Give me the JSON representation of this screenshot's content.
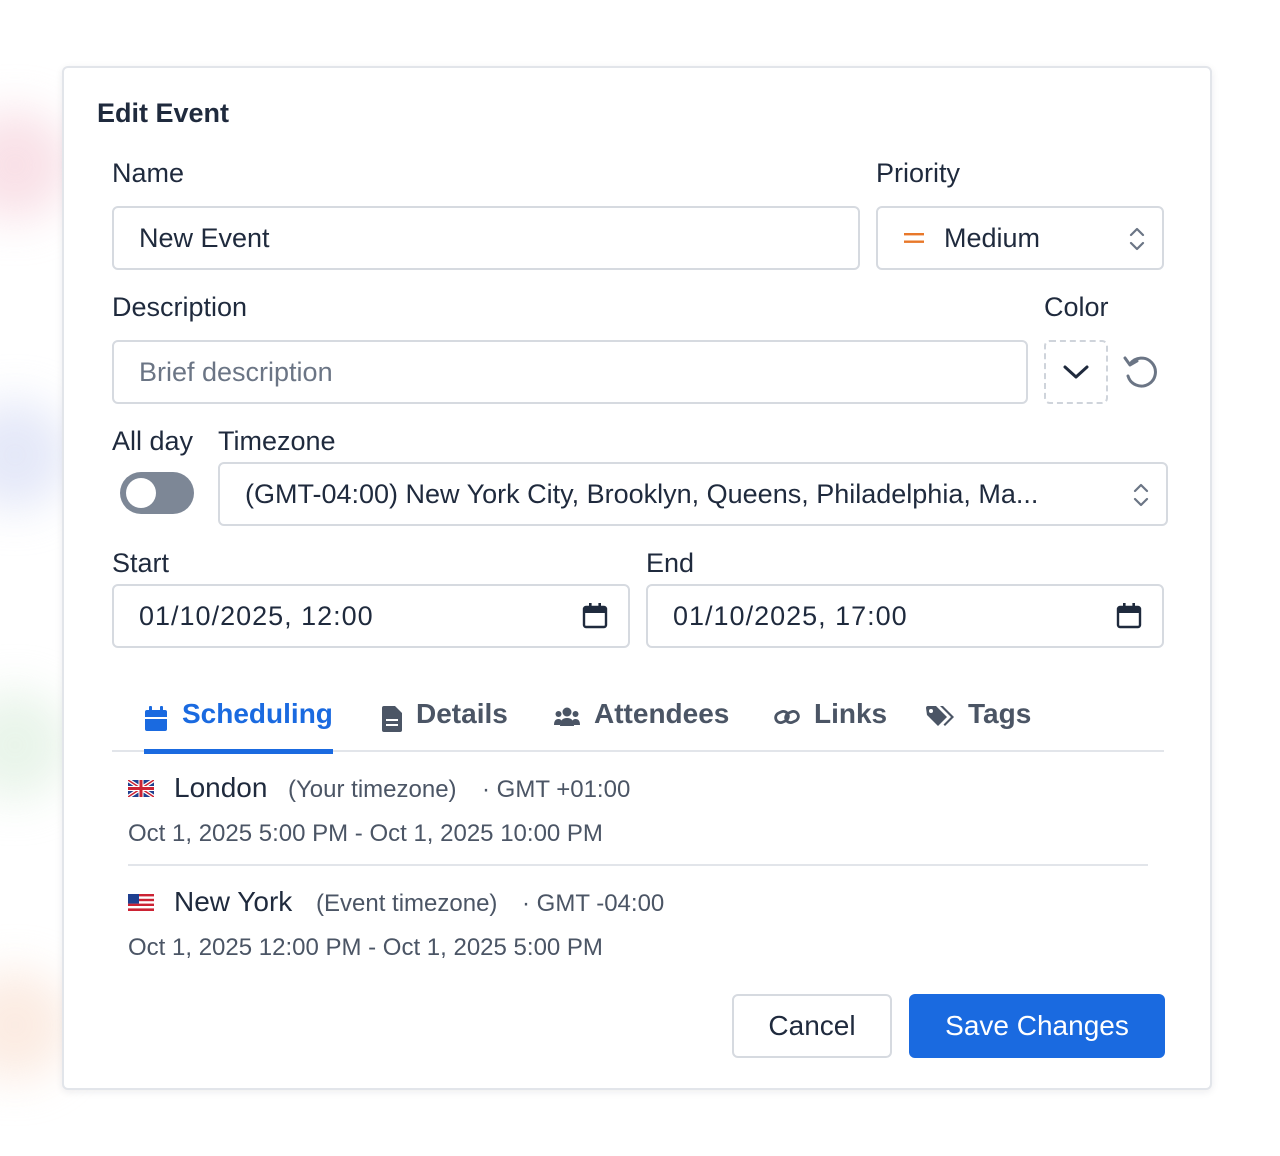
{
  "dialog": {
    "title": "Edit Event",
    "name_label": "Name",
    "name_value": "New Event",
    "priority_label": "Priority",
    "priority_value": "Medium",
    "description_label": "Description",
    "description_placeholder": "Brief description",
    "color_label": "Color",
    "all_day_label": "All day",
    "all_day_on": false,
    "timezone_label": "Timezone",
    "timezone_value": "(GMT-04:00) New York City, Brooklyn, Queens, Philadelphia, Ma...",
    "start_label": "Start",
    "start_value": "01/10/2025, 12:00",
    "end_label": "End",
    "end_value": "01/10/2025, 17:00"
  },
  "tabs": [
    {
      "label": "Scheduling",
      "icon": "calendar-icon",
      "active": true
    },
    {
      "label": "Details",
      "icon": "document-icon",
      "active": false
    },
    {
      "label": "Attendees",
      "icon": "users-icon",
      "active": false
    },
    {
      "label": "Links",
      "icon": "link-icon",
      "active": false
    },
    {
      "label": "Tags",
      "icon": "tags-icon",
      "active": false
    }
  ],
  "scheduling": [
    {
      "flag": "uk-flag-icon",
      "city": "London",
      "note": "(Your timezone)",
      "offset": "· GMT +01:00",
      "range": "Oct 1, 2025 5:00 PM - Oct 1, 2025 10:00 PM"
    },
    {
      "flag": "us-flag-icon",
      "city": "New York",
      "note": "(Event timezone)",
      "offset": "· GMT -04:00",
      "range": "Oct 1, 2025 12:00 PM - Oct 1, 2025 5:00 PM"
    }
  ],
  "actions": {
    "cancel": "Cancel",
    "save": "Save Changes"
  },
  "colors": {
    "accent": "#1a6ae0",
    "priority_medium": "#e8782a",
    "toggle_off": "#7d8796",
    "text": "#1f2a3d",
    "muted": "#4b5565"
  }
}
